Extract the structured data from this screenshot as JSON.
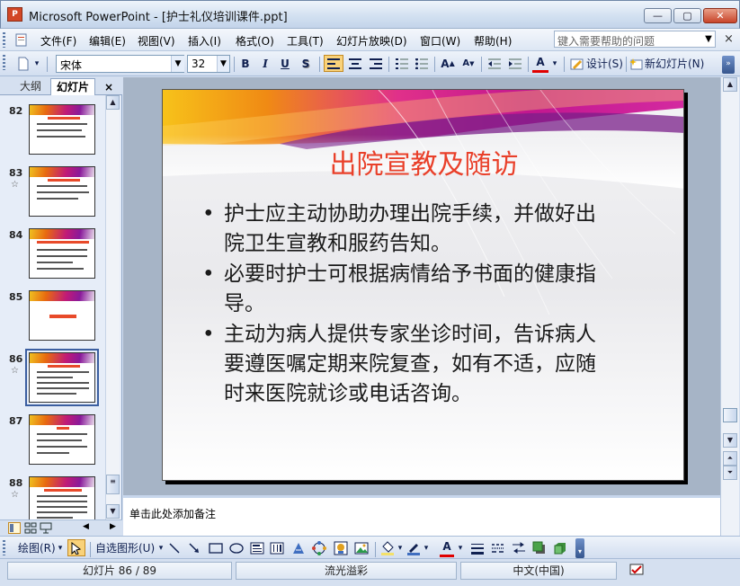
{
  "window": {
    "title": "Microsoft PowerPoint - [护士礼仪培训课件.ppt]",
    "app_icon": "powerpoint-icon",
    "min_label": "—",
    "max_label": "▢",
    "close_label": "✕"
  },
  "menu": {
    "items": [
      "文件(F)",
      "编辑(E)",
      "视图(V)",
      "插入(I)",
      "格式(O)",
      "工具(T)",
      "幻灯片放映(D)",
      "窗口(W)",
      "帮助(H)"
    ],
    "help_placeholder": "键入需要帮助的问题",
    "close": "×"
  },
  "toolbar": {
    "font_name": "宋体",
    "font_size": "32",
    "bold": "B",
    "italic": "I",
    "underline": "U",
    "shadow": "S",
    "font_color_label": "A",
    "design_label": "设计(S)",
    "new_slide_label": "新幻灯片(N)"
  },
  "left_panel": {
    "tab_outline": "大纲",
    "tab_slides": "幻灯片",
    "close": "×",
    "thumbnails": [
      {
        "number": "82",
        "star": ""
      },
      {
        "number": "83",
        "star": "☆"
      },
      {
        "number": "84",
        "star": ""
      },
      {
        "number": "85",
        "star": ""
      },
      {
        "number": "86",
        "star": "☆"
      },
      {
        "number": "87",
        "star": ""
      },
      {
        "number": "88",
        "star": "☆"
      }
    ],
    "selected_index": 4
  },
  "slide": {
    "title": "出院宣教及随访",
    "bullets": [
      {
        "line1": "护士应主动协助办理出院手续，并做好出",
        "line2": "院卫生宣教和服药告知。",
        "line3": ""
      },
      {
        "line1": "必要时护士可根据病情给予书面的健康指",
        "line2": "导。",
        "line3": ""
      },
      {
        "line1": "主动为病人提供专家坐诊时间，告诉病人",
        "line2": "要遵医嘱定期来院复查，如有不适，应随",
        "line3": "时来医院就诊或电话咨询。"
      }
    ],
    "title_color": "#e9402a"
  },
  "notes": {
    "placeholder": "单击此处添加备注"
  },
  "drawing_toolbar": {
    "draw_label": "绘图(R)",
    "autoshapes_label": "自选图形(U)"
  },
  "status": {
    "slide_position": "幻灯片 86 / 89",
    "design_name": "流光溢彩",
    "language": "中文(中国)"
  }
}
